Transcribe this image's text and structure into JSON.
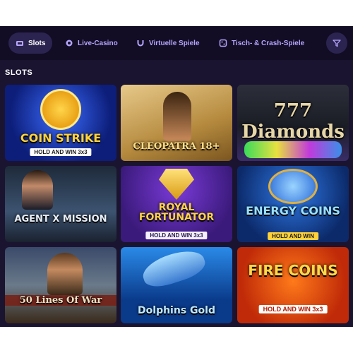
{
  "nav": {
    "tabs": [
      {
        "label": "Slots",
        "icon": "slot-machine-icon",
        "active": true
      },
      {
        "label": "Live-Casino",
        "icon": "live-casino-icon",
        "active": false
      },
      {
        "label": "Virtuelle Spiele",
        "icon": "horseshoe-icon",
        "active": false
      },
      {
        "label": "Tisch- & Crash-Spiele",
        "icon": "dice-icon",
        "active": false
      }
    ],
    "filter_icon": "filter-icon"
  },
  "section": {
    "title": "SLOTS"
  },
  "games": [
    {
      "title": "COIN STRIKE",
      "subtitle": "HOLD AND WIN 3x3"
    },
    {
      "title": "CLEOPATRA 18+",
      "subtitle": ""
    },
    {
      "title": "777 Diamonds",
      "subtitle": ""
    },
    {
      "title": "AGENT X MISSION",
      "subtitle": ""
    },
    {
      "title": "ROYAL FORTUNATOR",
      "subtitle": "HOLD AND WIN 3x3"
    },
    {
      "title": "ENERGY COINS",
      "subtitle": "HOLD AND WIN"
    },
    {
      "title": "50 Lines Of War",
      "subtitle": ""
    },
    {
      "title": "Dolphins Gold",
      "subtitle": ""
    },
    {
      "title": "FIRE COINS",
      "subtitle": "HOLD AND WIN 3x3"
    }
  ],
  "colors": {
    "accent": "#b7a6ff",
    "background": "#1a1430",
    "nav": "#120d24"
  }
}
